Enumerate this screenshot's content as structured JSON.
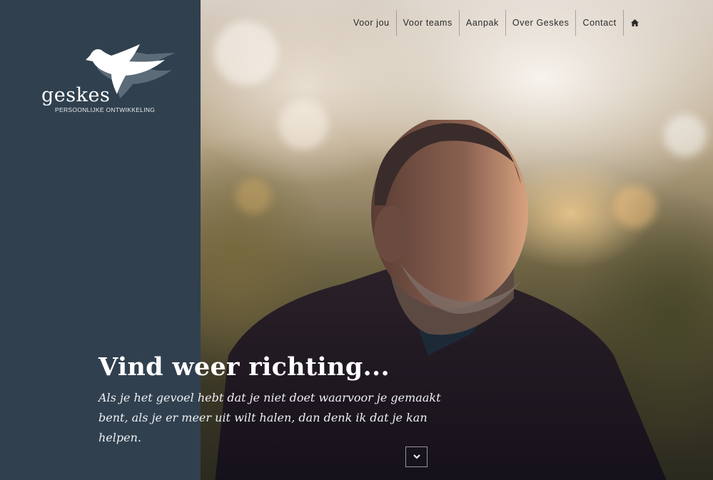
{
  "brand": {
    "name": "geskes",
    "tagline": "PERSOONLIJKE ONTWIKKELING",
    "logo_icon": "duck-icon"
  },
  "nav": {
    "items": [
      {
        "label": "Voor jou"
      },
      {
        "label": "Voor teams"
      },
      {
        "label": "Aanpak"
      },
      {
        "label": "Over Geskes"
      },
      {
        "label": "Contact"
      }
    ],
    "home_icon": "home-icon"
  },
  "hero": {
    "headline": "Vind weer richting...",
    "text": "Als je het gevoel hebt dat je niet doet waarvoor je gemaakt bent, als je er meer uit wilt halen, dan denk ik dat je kan helpen.",
    "scroll_icon": "chevron-down-icon"
  },
  "colors": {
    "sidebar": "#30404f",
    "text_light": "#ffffff",
    "nav_text": "#2a2a2a"
  }
}
